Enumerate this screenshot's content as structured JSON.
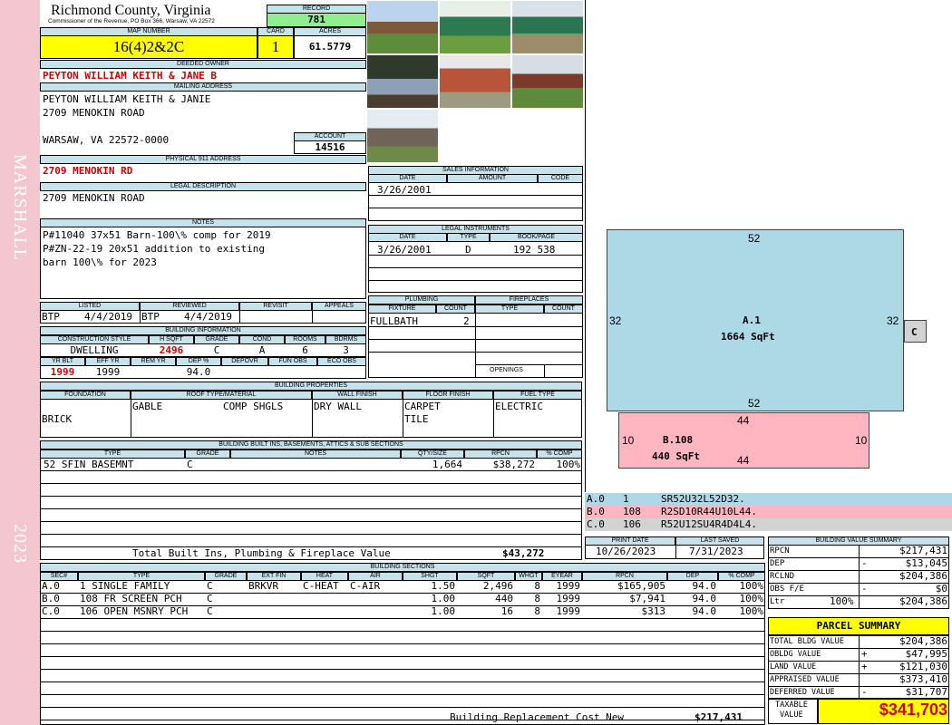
{
  "side": {
    "district": "MARSHALL",
    "year": "2023"
  },
  "header": {
    "county": "Richmond County, Virginia",
    "commissioner": "Commissioner of the Revenue, PO Box 366, Warsaw, VA 22572",
    "record_label": "RECORD",
    "record": "781",
    "map_label": "MAP NUMBER",
    "map": "16(4)2&2C",
    "card_label": "CARD",
    "card": "1",
    "acres_label": "ACRES",
    "acres": "61.5779"
  },
  "owner": {
    "label": "DEEDED OWNER",
    "name": "PEYTON WILLIAM KEITH & JANE B"
  },
  "mailing": {
    "label": "MAILING ADDRESS",
    "line1": "PEYTON WILLIAM KEITH & JANIE",
    "line2": "2709 MENOKIN ROAD",
    "line3": "WARSAW, VA 22572-0000"
  },
  "account": {
    "label": "ACCOUNT",
    "value": "14516"
  },
  "physical": {
    "label": "PHYSICAL 911 ADDRESS",
    "value": "2709 MENOKIN RD"
  },
  "legal": {
    "label": "LEGAL DESCRIPTION",
    "value": "2709 MENOKIN ROAD"
  },
  "notes": {
    "label": "NOTES",
    "line1": "P#11040 37x51 Barn-100\\% comp for 2019",
    "line2": "P#ZN-22-19 20x51 addition to existing",
    "line3": "barn 100\\% for 2023"
  },
  "listed": {
    "listed_label": "LISTED",
    "reviewed_label": "REVIEWED",
    "revisit_label": "REVISIT",
    "appeals_label": "APPEALS",
    "listed_by": "BTP",
    "listed_date": "4/4/2019",
    "reviewed_by": "BTP",
    "reviewed_date": "4/4/2019"
  },
  "building_info": {
    "label": "BUILDING INFORMATION",
    "h_style": "CONSTRUCTION STYLE",
    "h_sqft": "H SQFT",
    "h_grade": "GRADE",
    "h_cond": "COND",
    "h_rooms": "ROOMS",
    "h_bdrms": "BDRMS",
    "style": "DWELLING",
    "sqft": "2496",
    "grade": "C",
    "cond": "A",
    "rooms": "6",
    "bdrms": "3",
    "h_yrblt": "YR BLT",
    "h_effyr": "EFF YR",
    "h_remyr": "REM YR",
    "h_dep": "DEP %",
    "h_depovr": "DEPOVR",
    "h_funobs": "FUN OBS",
    "h_ecoobs": "ECO OBS",
    "yrblt": "1999",
    "effyr": "1999",
    "dep": "94.0"
  },
  "sales": {
    "label": "SALES INFORMATION",
    "h_date": "DATE",
    "h_amount": "AMOUNT",
    "h_code": "CODE",
    "date": "3/26/2001"
  },
  "instruments": {
    "label": "LEGAL INSTRUMENTS",
    "h_date": "DATE",
    "h_type": "TYPE",
    "h_book": "BOOK/PAGE",
    "date": "3/26/2001",
    "type": "D",
    "book": "192 538"
  },
  "plumbing": {
    "label": "PLUMBING",
    "h_fixture": "FIXTURE",
    "h_count": "COUNT",
    "fixture": "FULLBATH",
    "count": "2"
  },
  "fireplaces": {
    "label": "FIREPLACES",
    "h_type": "TYPE",
    "h_count": "COUNT",
    "h_openings": "OPENINGS"
  },
  "props": {
    "label": "BUILDING PROPERTIES",
    "h_foundation": "FOUNDATION",
    "h_roof": "ROOF TYPE/MATERIAL",
    "h_wall": "WALL FINISH",
    "h_floor": "FLOOR FINISH",
    "h_fuel": "FUEL TYPE",
    "foundation": "BRICK",
    "roof_type": "GABLE",
    "roof_mat": "COMP SHGLS",
    "wall": "DRY WALL",
    "floor1": "CARPET",
    "floor2": "TILE",
    "fuel": "ELECTRIC"
  },
  "builtins": {
    "label": "BUILDING BUILT INS, BASEMENTS, ATTICS & SUB SECTIONS",
    "h_type": "TYPE",
    "h_grade": "GRADE",
    "h_notes": "NOTES",
    "h_qty": "QTY/SIZE",
    "h_rpcn": "RPCN",
    "h_comp": "% COMP",
    "rows": [
      {
        "type": "52 SFIN BASEMNT",
        "grade": "C",
        "qty": "1,664",
        "rpcn": "$38,272",
        "comp": "100%"
      }
    ],
    "total_label": "Total Built Ins, Plumbing & Fireplace Value",
    "total": "$43,272"
  },
  "sections": {
    "label": "BUILDING SECTIONS",
    "headers": [
      "SEC#",
      "TYPE",
      "GRADE",
      "EXT FIN",
      "HEAT",
      "AIR",
      "SHGT",
      "SQFT",
      "WHGT",
      "EYEAR",
      "RPCN",
      "DEP",
      "% COMP"
    ],
    "rows": [
      {
        "sec": "A.0",
        "type": "1 SINGLE FAMILY",
        "grade": "C",
        "ext": "BRKVR",
        "heat": "C-HEAT",
        "air": "C-AIR",
        "shgt": "1.50",
        "sqft": "2,496",
        "whgt": "8",
        "eyear": "1999",
        "rpcn": "$165,905",
        "dep": "94.0",
        "comp": "100%"
      },
      {
        "sec": "B.0",
        "type": "108 FR SCREEN PCH",
        "grade": "C",
        "ext": "",
        "heat": "",
        "air": "",
        "shgt": "1.00",
        "sqft": "440",
        "whgt": "8",
        "eyear": "1999",
        "rpcn": "$7,941",
        "dep": "94.0",
        "comp": "100%"
      },
      {
        "sec": "C.0",
        "type": "106 OPEN MSNRY PCH",
        "grade": "C",
        "ext": "",
        "heat": "",
        "air": "",
        "shgt": "1.00",
        "sqft": "16",
        "whgt": "8",
        "eyear": "1999",
        "rpcn": "$313",
        "dep": "94.0",
        "comp": "100%"
      }
    ],
    "total_label": "Building Replacement Cost New",
    "total": "$217,431"
  },
  "sketch": {
    "a_top": "52",
    "a_left": "32",
    "a_right": "32",
    "a_bottom": "52",
    "a_name": "A.1",
    "a_area": "1664 SqFt",
    "b_top": "44",
    "b_left": "10",
    "b_right": "10",
    "b_bottom": "44",
    "b_name": "B.108",
    "b_area": "440 SqFt",
    "c_name": "C",
    "legend": [
      {
        "sec": "A.0",
        "code": "1",
        "path": "SR52U32L52D32.",
        "color": "#add8e6"
      },
      {
        "sec": "B.0",
        "code": "108",
        "path": "R2SD10R44U10L44.",
        "color": "#ffb6c1"
      },
      {
        "sec": "C.0",
        "code": "106",
        "path": "R52U12SU4R4D4L4.",
        "color": "#d3d3d3"
      }
    ]
  },
  "dates": {
    "print_label": "PRINT DATE",
    "print": "10/26/2023",
    "saved_label": "LAST SAVED",
    "saved": "7/31/2023"
  },
  "bvs": {
    "label": "BUILDING VALUE SUMMARY",
    "rpcn_l": "RPCN",
    "rpcn": "$217,431",
    "dep_l": "DEP",
    "dep_sign": "-",
    "dep": "$13,045",
    "rclnd_l": "RCLND",
    "rclnd": "$204,386",
    "obs_l": "OBS F/E",
    "obs_sign": "-",
    "obs": "$0",
    "ltr_l": "Ltr",
    "ltr_pct": "100%",
    "ltr": "$204,386"
  },
  "parcel": {
    "label": "PARCEL SUMMARY",
    "bldg_l": "TOTAL BLDG VALUE",
    "bldg": "$204,386",
    "obldg_l": "OBLDG VALUE",
    "obldg_sign": "+",
    "obldg": "$47,995",
    "land_l": "LAND VALUE",
    "land_sign": "+",
    "land": "$121,030",
    "appraised_l": "APPRAISED VALUE",
    "appraised": "$373,410",
    "deferred_l": "DEFERRED VALUE",
    "deferred_sign": "-",
    "deferred": "$31,707",
    "taxable_l1": "TAXABLE",
    "taxable_l2": "VALUE",
    "taxable": "$341,703"
  },
  "colors": {
    "label_bg": "#c6e3ec",
    "yellow": "#ffff00",
    "green": "#90ee90",
    "pink": "#f4c6cf",
    "red": "#cc0000"
  }
}
